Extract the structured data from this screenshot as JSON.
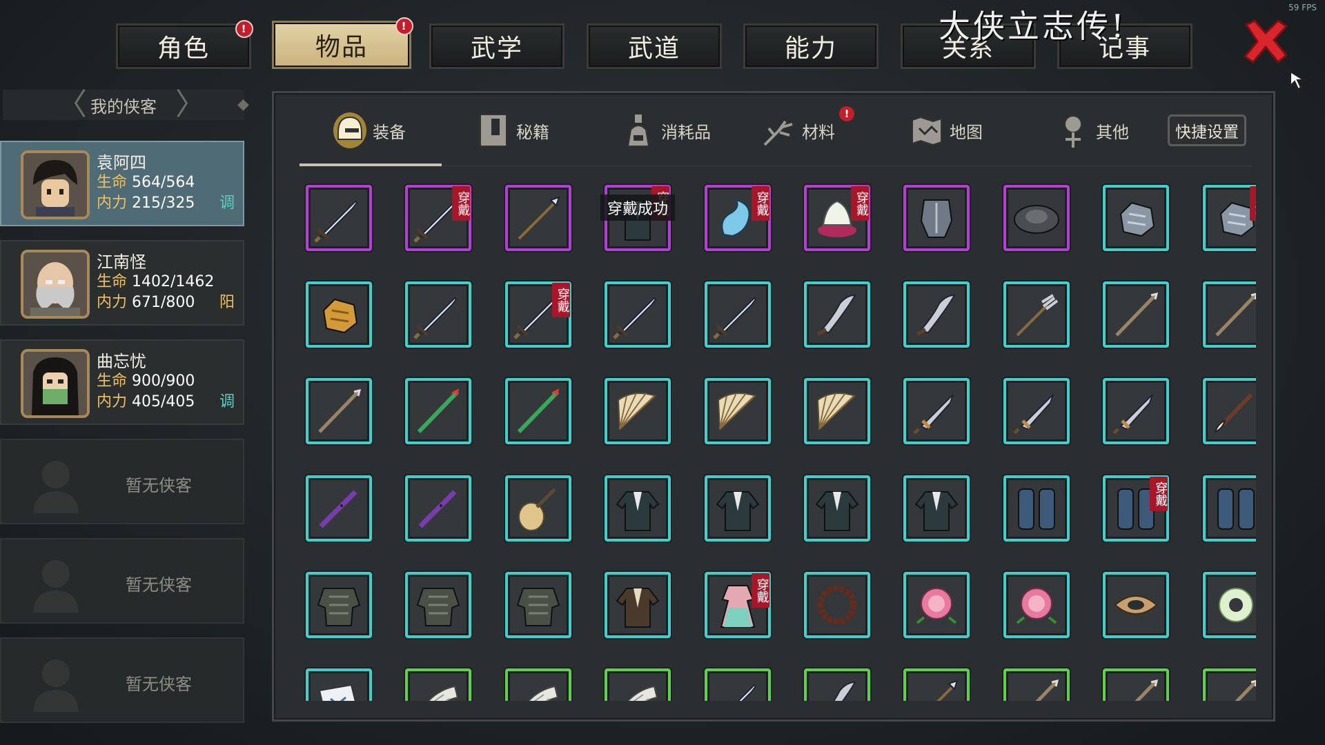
{
  "fps": "59 FPS",
  "banner": "大侠立志传!",
  "top_tabs": [
    {
      "label": "角色",
      "badge": "!"
    },
    {
      "label": "物品",
      "badge": "!"
    },
    {
      "label": "武学"
    },
    {
      "label": "武道"
    },
    {
      "label": "能力"
    },
    {
      "label": "关系"
    },
    {
      "label": "记事"
    }
  ],
  "roster": {
    "title": "我的侠客",
    "heroes": [
      {
        "name": "袁阿四",
        "hp_label": "生命",
        "hp": "564/564",
        "mp_label": "内力",
        "mp": "215/325",
        "tag": "调"
      },
      {
        "name": "江南怪",
        "hp_label": "生命",
        "hp": "1402/1462",
        "mp_label": "内力",
        "mp": "671/800",
        "tag": "阳"
      },
      {
        "name": "曲忘忧",
        "hp_label": "生命",
        "hp": "900/900",
        "mp_label": "内力",
        "mp": "405/405",
        "tag": "调"
      }
    ],
    "empty_label": "暂无侠客"
  },
  "categories": [
    {
      "label": "装备",
      "icon": "helmet-icon"
    },
    {
      "label": "秘籍",
      "icon": "book-icon"
    },
    {
      "label": "消耗品",
      "icon": "potion-icon"
    },
    {
      "label": "材料",
      "icon": "herb-icon",
      "badge": "!"
    },
    {
      "label": "地图",
      "icon": "map-icon"
    },
    {
      "label": "其他",
      "icon": "misc-icon"
    }
  ],
  "quick_settings": "快捷设置",
  "tooltip": "穿戴成功",
  "worn_label": "穿戴",
  "colors": {
    "rare": "#b53fd6",
    "uncommon": "#3fd0cc",
    "common": "#5ed04a",
    "worn": "#a8162a"
  },
  "items": [
    {
      "icon": "sword-icon",
      "rarity": "purple"
    },
    {
      "icon": "sword-icon",
      "rarity": "purple",
      "worn": true
    },
    {
      "icon": "spear-icon",
      "rarity": "purple"
    },
    {
      "icon": "robe-icon",
      "rarity": "purple",
      "worn": true
    },
    {
      "icon": "dragon-ornament-icon",
      "rarity": "purple",
      "worn": true
    },
    {
      "icon": "lotus-icon",
      "rarity": "purple",
      "worn": true
    },
    {
      "icon": "iron-armor-icon",
      "rarity": "purple"
    },
    {
      "icon": "hat-icon",
      "rarity": "purple"
    },
    {
      "icon": "gauntlet-icon",
      "rarity": "cyan"
    },
    {
      "icon": "gauntlet-icon",
      "rarity": "cyan",
      "worn": true
    },
    {
      "icon": "glove-icon",
      "rarity": "cyan"
    },
    {
      "icon": "sword-icon",
      "rarity": "cyan"
    },
    {
      "icon": "sword-icon",
      "rarity": "cyan",
      "worn": true
    },
    {
      "icon": "sword-icon",
      "rarity": "cyan"
    },
    {
      "icon": "sword-icon",
      "rarity": "cyan"
    },
    {
      "icon": "saber-icon",
      "rarity": "cyan"
    },
    {
      "icon": "saber-icon",
      "rarity": "cyan"
    },
    {
      "icon": "trident-icon",
      "rarity": "cyan"
    },
    {
      "icon": "staff-icon",
      "rarity": "cyan"
    },
    {
      "icon": "staff-icon",
      "rarity": "cyan"
    },
    {
      "icon": "staff-icon",
      "rarity": "cyan"
    },
    {
      "icon": "bamboo-staff-icon",
      "rarity": "cyan"
    },
    {
      "icon": "bamboo-staff-icon",
      "rarity": "cyan"
    },
    {
      "icon": "fan-icon",
      "rarity": "cyan"
    },
    {
      "icon": "fan-icon",
      "rarity": "cyan"
    },
    {
      "icon": "fan-icon",
      "rarity": "cyan"
    },
    {
      "icon": "dagger-icon",
      "rarity": "cyan"
    },
    {
      "icon": "dagger-icon",
      "rarity": "cyan"
    },
    {
      "icon": "dagger-icon",
      "rarity": "cyan"
    },
    {
      "icon": "brush-icon",
      "rarity": "cyan"
    },
    {
      "icon": "flute-icon",
      "rarity": "cyan"
    },
    {
      "icon": "flute-icon",
      "rarity": "cyan"
    },
    {
      "icon": "pipa-icon",
      "rarity": "cyan"
    },
    {
      "icon": "robe-icon",
      "rarity": "cyan"
    },
    {
      "icon": "robe-icon",
      "rarity": "cyan"
    },
    {
      "icon": "robe-icon",
      "rarity": "cyan"
    },
    {
      "icon": "robe-icon",
      "rarity": "cyan"
    },
    {
      "icon": "greaves-icon",
      "rarity": "cyan"
    },
    {
      "icon": "greaves-icon",
      "rarity": "cyan",
      "worn": true
    },
    {
      "icon": "greaves-icon",
      "rarity": "cyan"
    },
    {
      "icon": "lamellar-armor-icon",
      "rarity": "cyan"
    },
    {
      "icon": "lamellar-armor-icon",
      "rarity": "cyan"
    },
    {
      "icon": "lamellar-armor-icon",
      "rarity": "cyan"
    },
    {
      "icon": "brown-robe-icon",
      "rarity": "cyan"
    },
    {
      "icon": "pink-dress-icon",
      "rarity": "cyan",
      "worn": true
    },
    {
      "icon": "prayer-beads-icon",
      "rarity": "cyan"
    },
    {
      "icon": "peony-icon",
      "rarity": "cyan"
    },
    {
      "icon": "peony-icon",
      "rarity": "cyan"
    },
    {
      "icon": "amulet-icon",
      "rarity": "cyan"
    },
    {
      "icon": "jade-ring-icon",
      "rarity": "cyan"
    },
    {
      "icon": "scroll-map-icon",
      "rarity": "cyan"
    },
    {
      "icon": "bandage-icon",
      "rarity": "green"
    },
    {
      "icon": "bandage-icon",
      "rarity": "green"
    },
    {
      "icon": "bandage-icon",
      "rarity": "green"
    },
    {
      "icon": "sword-icon",
      "rarity": "green"
    },
    {
      "icon": "saber-icon",
      "rarity": "green"
    },
    {
      "icon": "spear-icon",
      "rarity": "green"
    },
    {
      "icon": "staff-icon",
      "rarity": "green"
    },
    {
      "icon": "staff-icon",
      "rarity": "green"
    },
    {
      "icon": "staff-icon",
      "rarity": "green"
    }
  ]
}
